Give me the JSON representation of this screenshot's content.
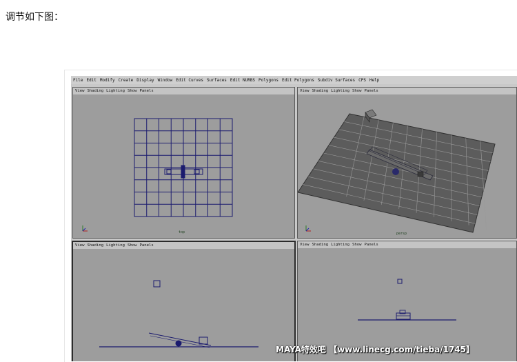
{
  "heading": "调节如下图：",
  "maya": {
    "menus": [
      "File",
      "Edit",
      "Modify",
      "Create",
      "Display",
      "Window",
      "Edit Curves",
      "Surfaces",
      "Edit NURBS",
      "Polygons",
      "Edit Polygons",
      "Subdiv Surfaces",
      "CPS",
      "Help"
    ],
    "panel_menus": [
      "View",
      "Shading",
      "Lighting",
      "Show",
      "Panels"
    ],
    "viewports": [
      {
        "id": "top",
        "label": "top"
      },
      {
        "id": "persp",
        "label": "persp"
      },
      {
        "id": "front",
        "label": ""
      },
      {
        "id": "side",
        "label": ""
      }
    ]
  },
  "watermark": "MAYA特效吧 【www.linecg.com/tieba/1745】",
  "colors": {
    "viewport_bg": "#9d9d9d",
    "grid_line": "#1b1b6e",
    "persp_plane": "#5c5c5c",
    "active_border": "#2b2b2b"
  }
}
